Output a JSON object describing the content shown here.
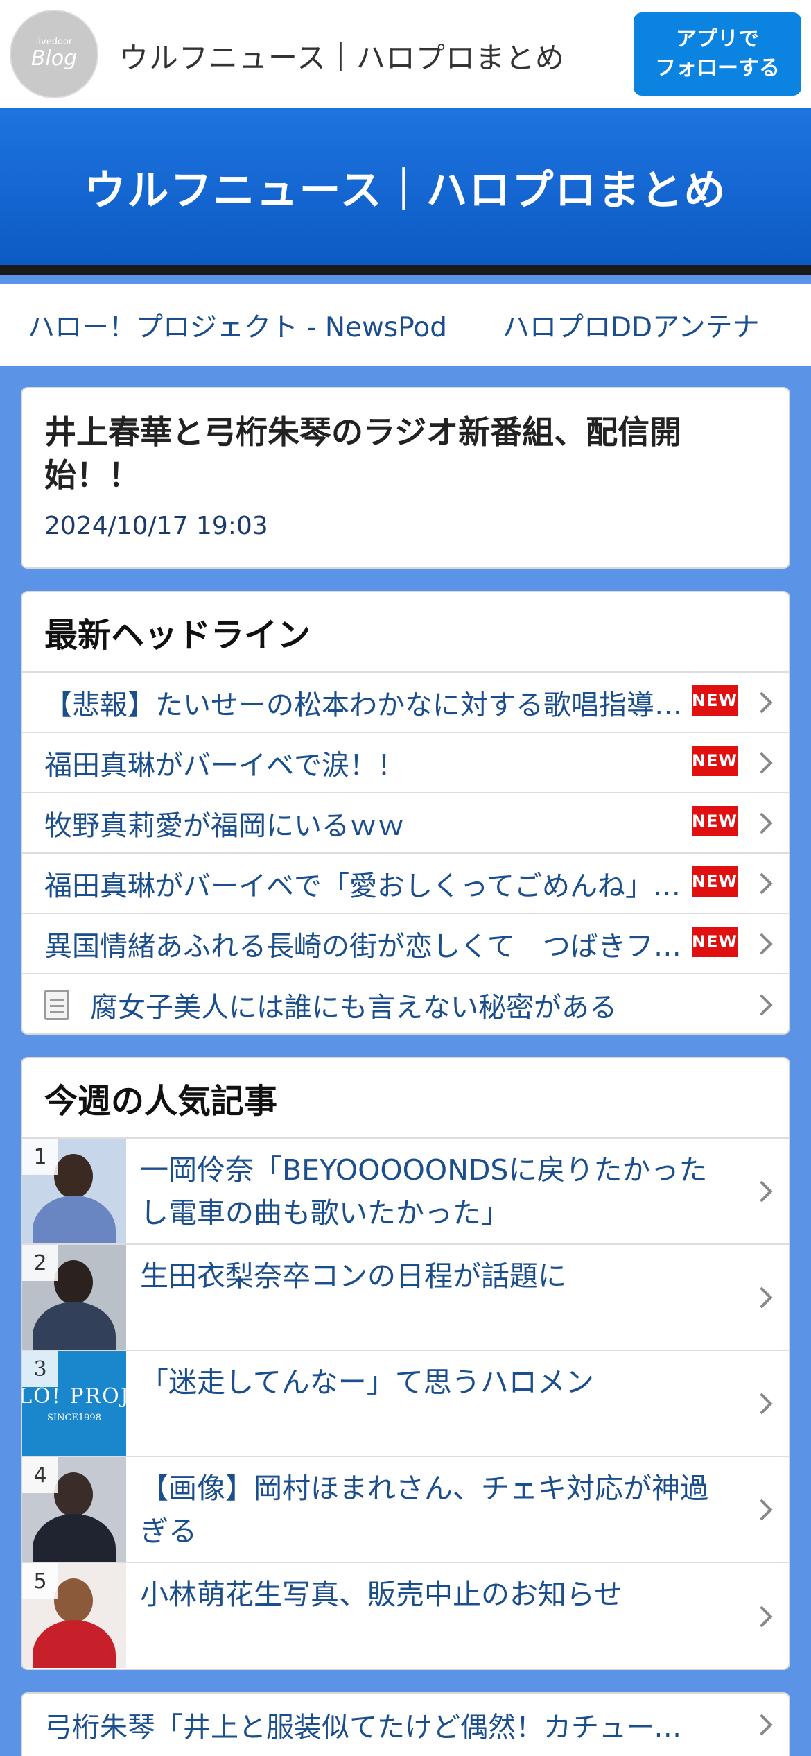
{
  "topbar": {
    "logo_small": "livedoor",
    "logo_big": "Blog",
    "site_name": "ウルフニュース｜ハロプロまとめ",
    "follow_line1": "アプリで",
    "follow_line2": "フォローする"
  },
  "hero": {
    "title": "ウルフニュース｜ハロプロまとめ"
  },
  "links": [
    {
      "label": "ハロー！プロジェクト - NewsPod"
    },
    {
      "label": "ハロプロDDアンテナ"
    }
  ],
  "article": {
    "title": "井上春華と弓桁朱琴のラジオ新番組、配信開始！！",
    "date": "2024/10/17 19:03"
  },
  "headlines": {
    "title": "最新ヘッドライン",
    "new_label": "NEW",
    "items": [
      {
        "text": "【悲報】たいせーの松本わかなに対する歌唱指導がひどすぎる…"
      },
      {
        "text": "福田真琳がバーイベで涙！！"
      },
      {
        "text": "牧野真莉愛が福岡にいるｗｗ"
      },
      {
        "text": "福田真琳がバーイベで「愛おしくってごめんね」を歌唱"
      },
      {
        "text": "異国情緒あふれる長崎の街が恋しくて　つばきファクトリー"
      },
      {
        "text": "腐女子美人には誰にも言えない秘密がある"
      }
    ]
  },
  "popular": {
    "title": "今週の人気記事",
    "items": [
      {
        "rank": "1",
        "text": "一岡伶奈「BEYOOOOONDSに戻りたかったし電車の曲も歌いたかった」"
      },
      {
        "rank": "2",
        "text": "生田衣梨奈卒コンの日程が話題に"
      },
      {
        "rank": "3",
        "text": "「迷走してんなー」て思うハロメン",
        "thumb_big": "LO! PROJ",
        "thumb_small": "SINCE1998"
      },
      {
        "rank": "4",
        "text": "【画像】岡村ほまれさん、チェキ対応が神過ぎる"
      },
      {
        "rank": "5",
        "text": "小林萌花生写真、販売中止のお知らせ"
      }
    ]
  },
  "bottom": {
    "items": [
      {
        "text": "弓桁朱琴「井上と服装似てたけど偶然！カチューシャも」"
      }
    ]
  }
}
